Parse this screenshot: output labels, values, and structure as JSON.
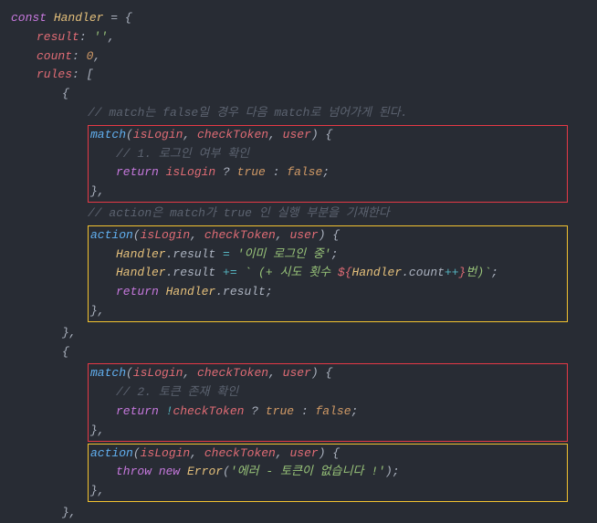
{
  "code": {
    "l1_const": "const",
    "l1_name": "Handler",
    "l1_eq": " = {",
    "l2_prop": "result",
    "l2_val": "''",
    "l3_prop": "count",
    "l3_val": "0",
    "l4_prop": "rules",
    "l4_val": "[",
    "l5": "{",
    "comment1": "// match는 false일 경우 다음 match로 넘어가게 된다.",
    "m1_name": "match",
    "m1_p1": "isLogin",
    "m1_p2": "checkToken",
    "m1_p3": "user",
    "m1_open": ") {",
    "m1_comment": "// 1. 로그인 여부 확인",
    "kw_return": "return",
    "m1_var": "isLogin",
    "m1_q": " ? ",
    "m1_true": "true",
    "m1_colon": " : ",
    "m1_false": "false",
    "close_method": "},",
    "comment2": "// action은 match가 true 인 실행 부분을 기재한다",
    "a1_name": "action",
    "a1_l1a": "Handler",
    "a1_l1b": ".result ",
    "a1_l1c": "=",
    "a1_l1d": " '이미 로그인 중'",
    "a1_l2a": "Handler",
    "a1_l2b": ".result ",
    "a1_l2c": "+=",
    "a1_l2d": " ` (+ 시도 횟수 ",
    "a1_l2e": "${",
    "a1_l2f": "Handler",
    "a1_l2g": ".count",
    "a1_l2h": "++",
    "a1_l2i": "}",
    "a1_l2j": "번)`",
    "a1_ret": "Handler",
    "a1_ret2": ".result;",
    "close_obj": "},",
    "open_obj": "{",
    "m2_comment": "// 2. 토큰 존재 확인",
    "m2_neg": "!",
    "m2_var": "checkToken",
    "kw_throw": "throw",
    "kw_new": "new",
    "err_class": "Error",
    "err_msg": "'에러 - 토큰이 없습니다 !'",
    "semicolon": ";",
    "comma": ",",
    "space": " "
  }
}
